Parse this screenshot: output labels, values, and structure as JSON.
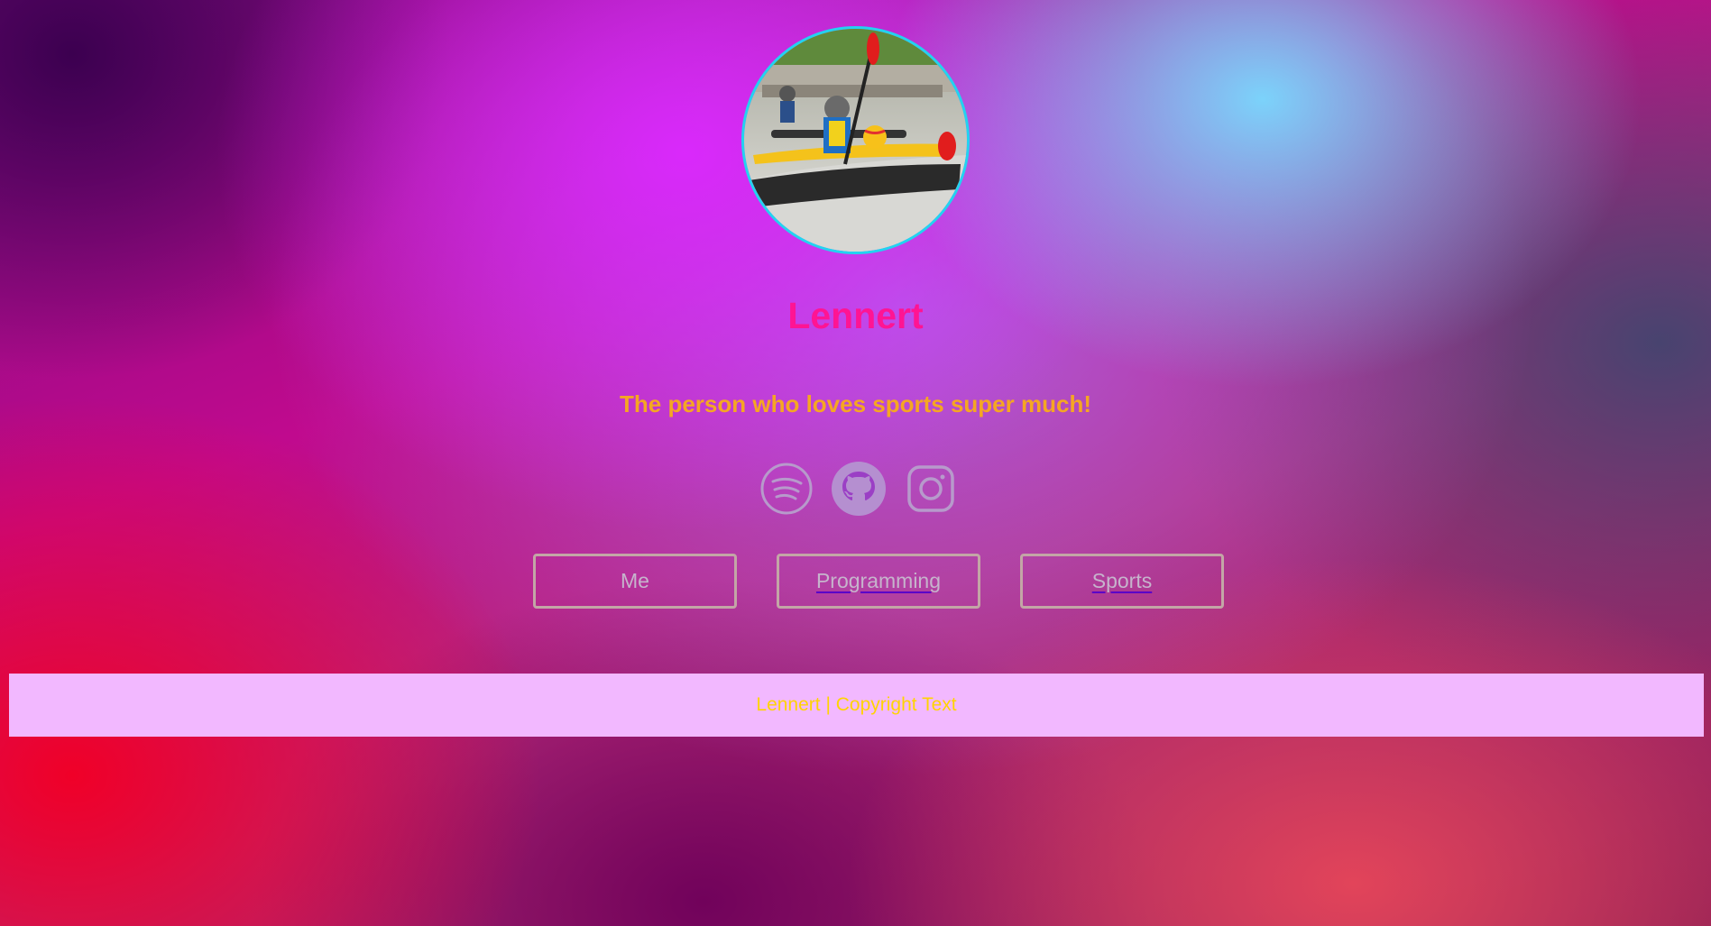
{
  "profile": {
    "avatar_alt": "Kayak polo player holding a ball and paddle",
    "name": "Lennert",
    "tagline": "The person who loves sports super much!"
  },
  "socials": [
    {
      "icon": "spotify-icon"
    },
    {
      "icon": "github-icon"
    },
    {
      "icon": "instagram-icon"
    }
  ],
  "nav": {
    "me_label": "Me",
    "programming_label": "Programming",
    "sports_label": "Sports"
  },
  "footer": {
    "text": "Lennert | Copyright Text"
  },
  "colors": {
    "name": "#ff1493",
    "tagline": "#f5a623",
    "avatar_border": "#22d3f0",
    "button_border": "#c3a6a6",
    "footer_bg": "#f2b8ff",
    "footer_text": "#ffd400"
  }
}
